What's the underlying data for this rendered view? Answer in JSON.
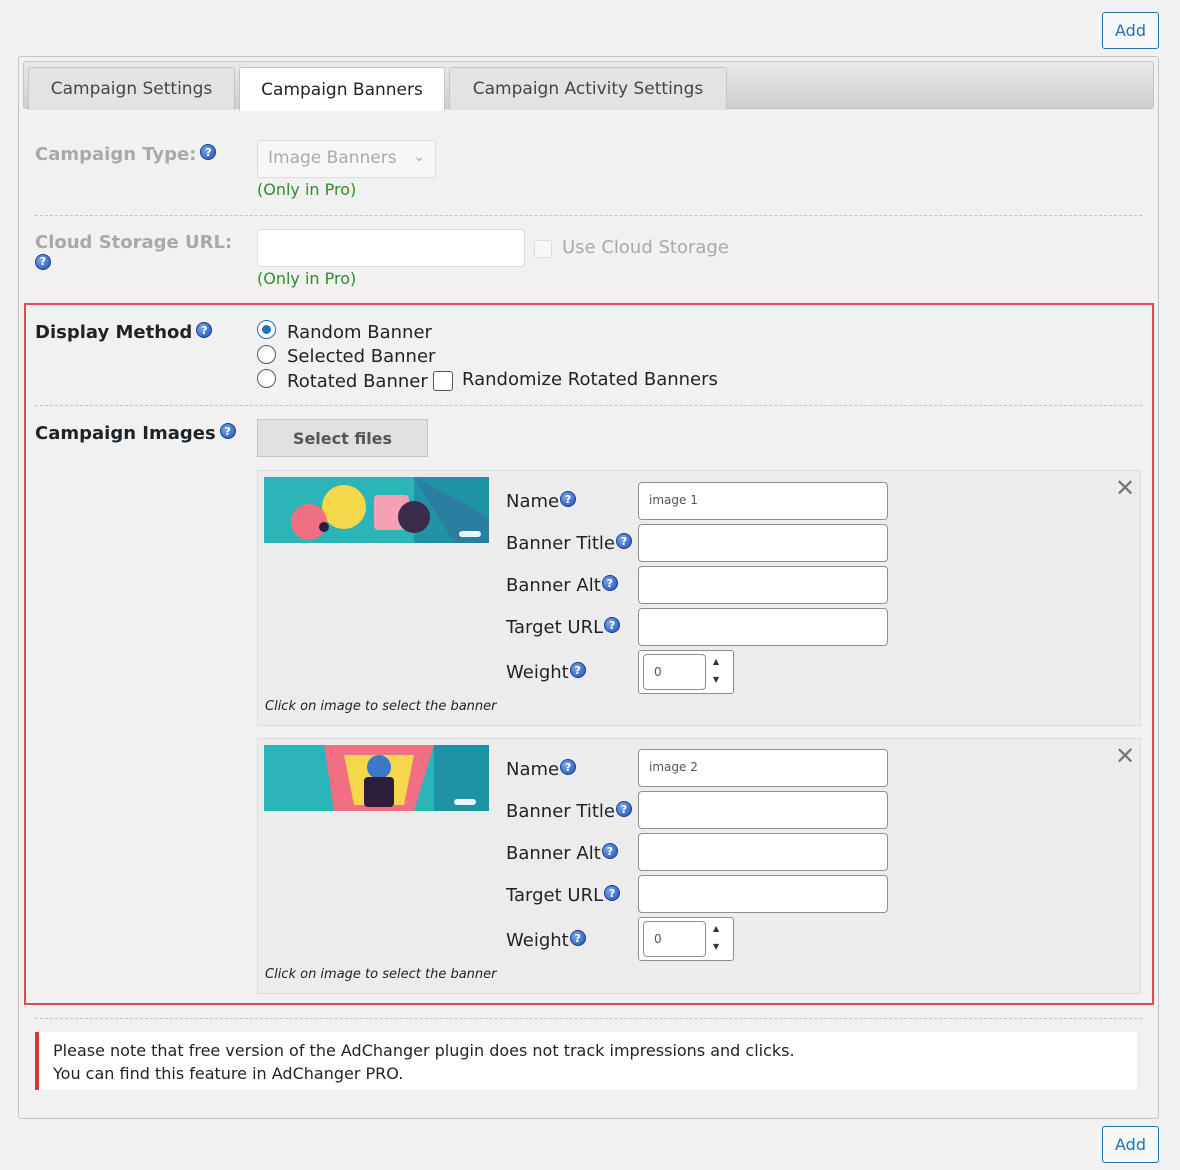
{
  "toolbar": {
    "add_label": "Add"
  },
  "tabs": [
    {
      "label": "Campaign Settings"
    },
    {
      "label": "Campaign Banners"
    },
    {
      "label": "Campaign Activity Settings"
    }
  ],
  "campaign_type": {
    "label": "Campaign Type:",
    "selected": "Image Banners",
    "pro_note": "(Only in Pro)"
  },
  "cloud_storage": {
    "label": "Cloud Storage URL:",
    "value": "",
    "checkbox_label": "Use Cloud Storage",
    "pro_note": "(Only in Pro)"
  },
  "display_method": {
    "label": "Display Method",
    "options": [
      "Random Banner",
      "Selected Banner",
      "Rotated Banner"
    ],
    "selected": "Random Banner",
    "randomize_label": "Randomize Rotated Banners"
  },
  "campaign_images": {
    "label": "Campaign Images",
    "select_files_label": "Select files",
    "field_labels": {
      "name": "Name",
      "banner_title": "Banner Title",
      "banner_alt": "Banner Alt",
      "target_url": "Target URL",
      "weight": "Weight"
    },
    "hint": "Click on image to select the banner",
    "banners": [
      {
        "name": "image 1",
        "banner_title": "",
        "banner_alt": "",
        "target_url": "",
        "weight": "0"
      },
      {
        "name": "image 2",
        "banner_title": "",
        "banner_alt": "",
        "target_url": "",
        "weight": "0"
      }
    ]
  },
  "notice": {
    "line1": "Please note that free version of the AdChanger plugin does not track impressions and clicks.",
    "line2": "You can find this feature in AdChanger PRO."
  },
  "colors": {
    "accent": "#2271b1",
    "highlight_border": "#e5484d",
    "notice_border": "#d63638",
    "pro_text": "#2e8b2e"
  }
}
